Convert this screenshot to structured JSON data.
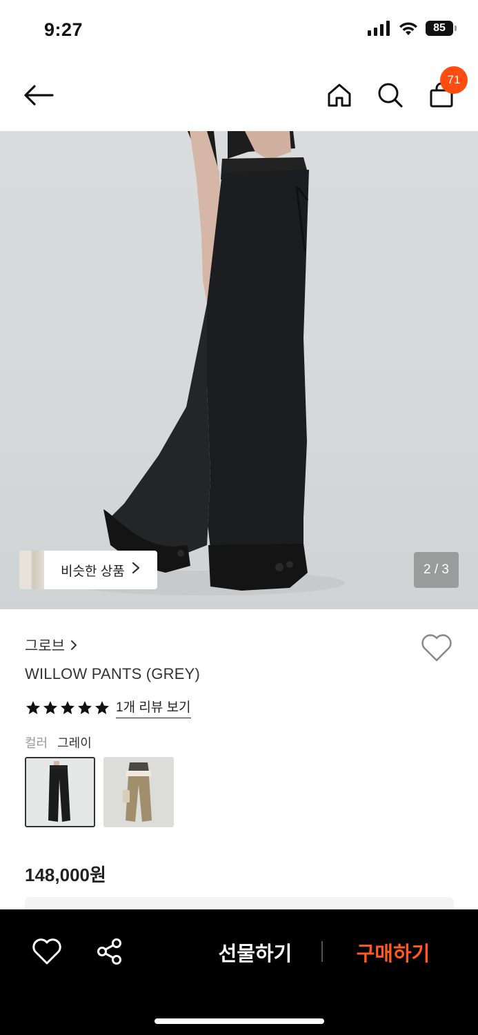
{
  "status_bar": {
    "time": "9:27",
    "battery": "85"
  },
  "header": {
    "cart_count": "71"
  },
  "gallery": {
    "similar_label": "비슷한 상품",
    "page_indicator": "2 / 3"
  },
  "product": {
    "brand": "그로브",
    "name": "WILLOW PANTS (GREY)",
    "rating_stars": 5,
    "review_link": "1개 리뷰 보기",
    "color_label": "컬러",
    "color_value": "그레이",
    "price": "148,000원"
  },
  "bottom_bar": {
    "gift_label": "선물하기",
    "buy_label": "구매하기"
  },
  "colors": {
    "accent": "#ff4d12",
    "buy": "#ff5a1f",
    "bar": "#000000"
  }
}
